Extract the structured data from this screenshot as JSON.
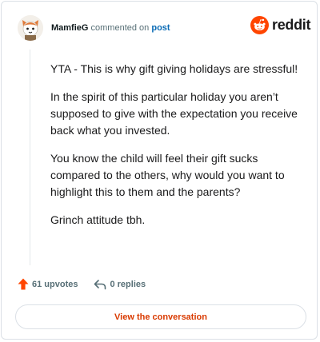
{
  "comment": {
    "username": "MamfieG",
    "action_text": "commented on",
    "target_link": "post",
    "paragraphs": [
      "YTA - This is why gift giving holidays are stressful!",
      "In the spirit of this particular holiday you aren’t supposed to give with the expectation you receive back what you invested.",
      "You know the child will feel their gift sucks compared to the others, why would you want to highlight this to them and the parents?",
      "Grinch attitude tbh."
    ],
    "upvotes_label": "61 upvotes",
    "replies_label": "0 replies"
  },
  "brand": {
    "wordmark": "reddit",
    "accent": "#ff4500",
    "icon": "reddit-logo-icon"
  },
  "cta": {
    "label": "View the conversation",
    "color": "#d93a00"
  },
  "icons": {
    "upvote": "upvote-arrow-icon",
    "reply": "reply-arrow-icon",
    "avatar": "avatar-image"
  }
}
